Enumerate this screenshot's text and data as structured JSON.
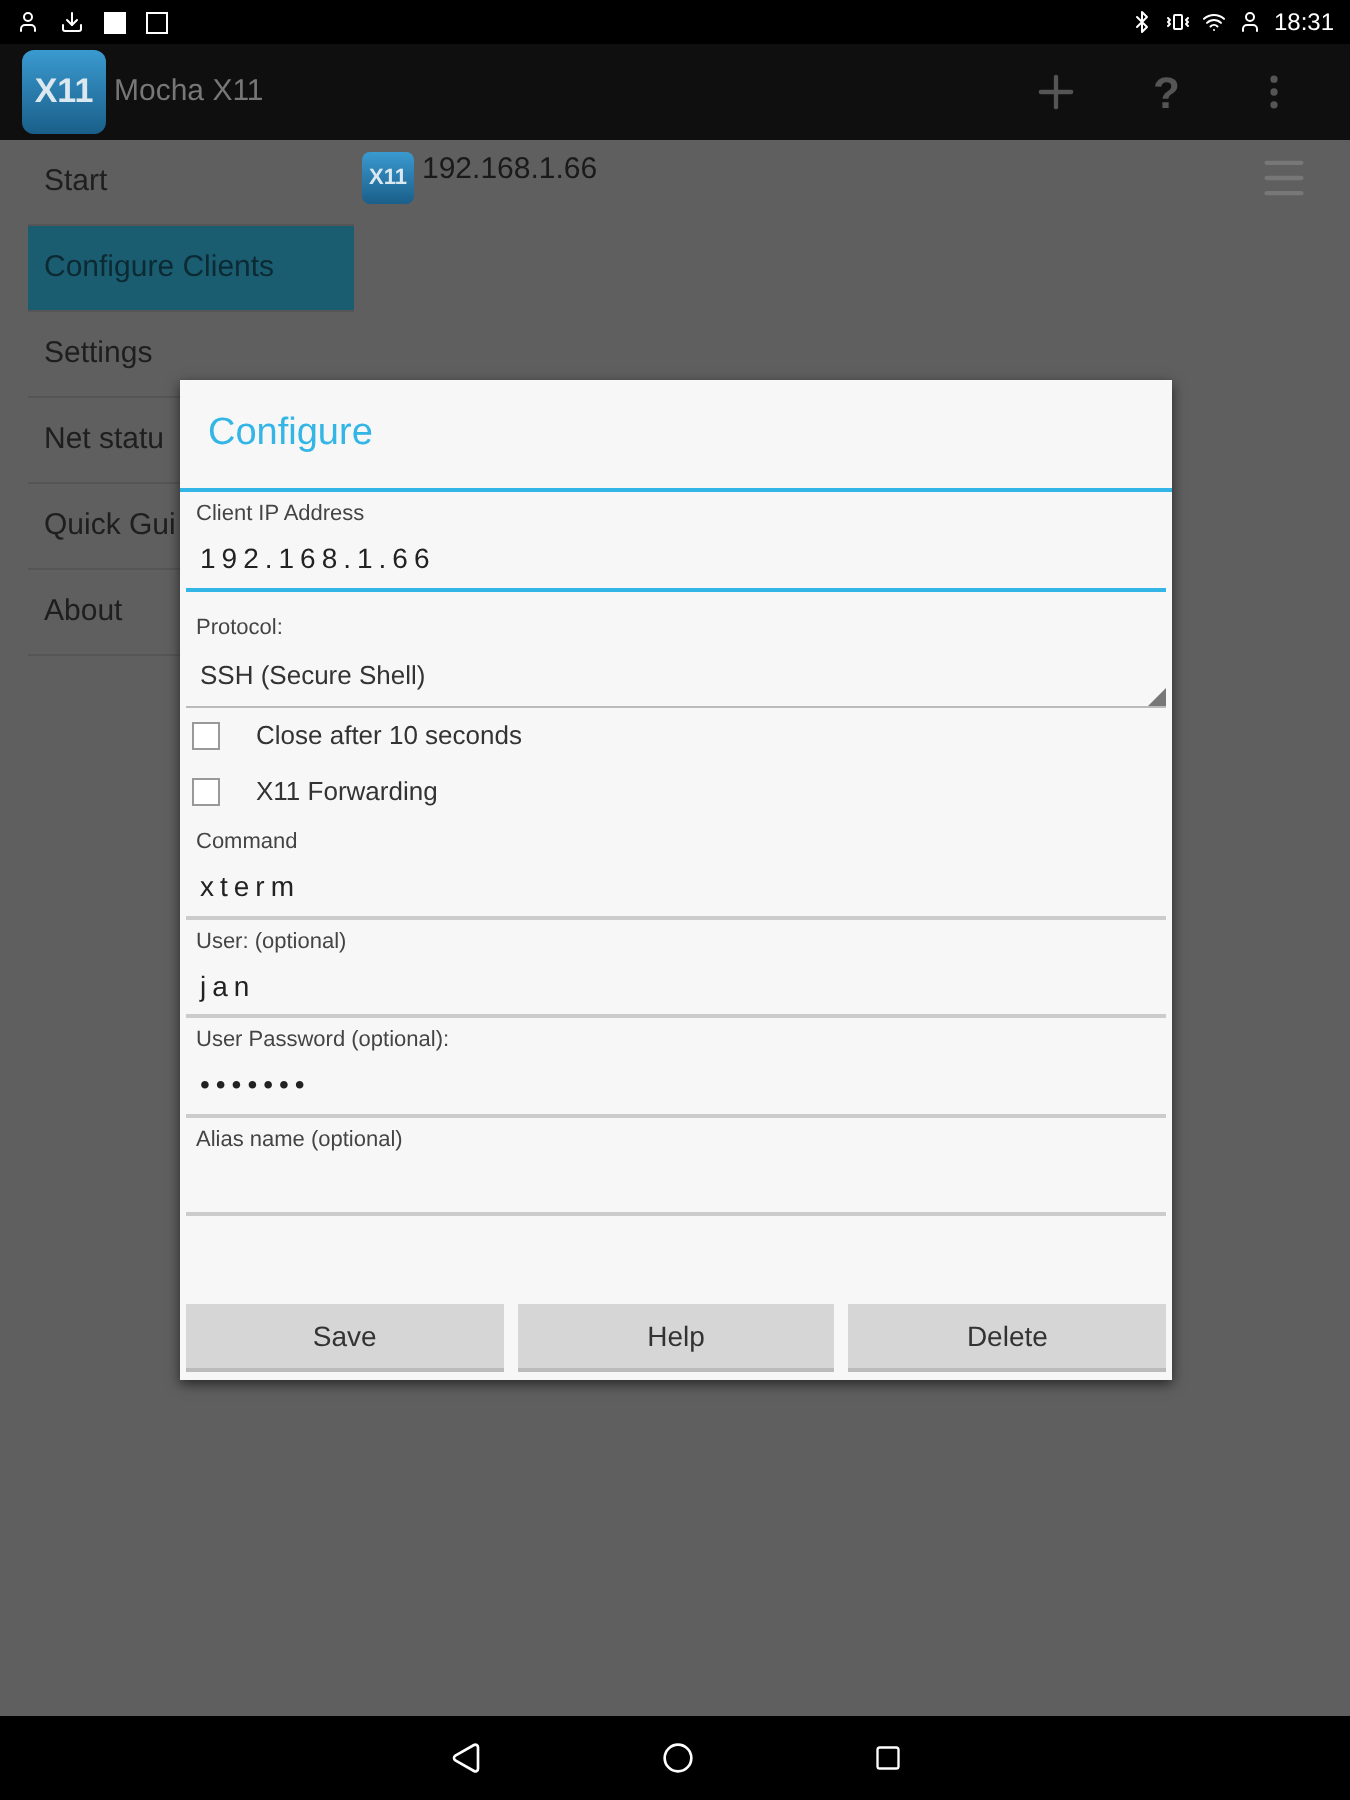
{
  "status_bar": {
    "time": "18:31"
  },
  "app_bar": {
    "logo": "X11",
    "title": "Mocha X11",
    "help": "?"
  },
  "sidebar": {
    "items": [
      {
        "label": "Start",
        "selected": false
      },
      {
        "label": "Configure Clients",
        "selected": true
      },
      {
        "label": "Settings",
        "selected": false
      },
      {
        "label": "Net statu",
        "selected": false
      },
      {
        "label": "Quick Gui",
        "selected": false
      },
      {
        "label": "About",
        "selected": false
      }
    ]
  },
  "clients": [
    {
      "logo": "X11",
      "address": "192.168.1.66"
    }
  ],
  "dialog": {
    "title": "Configure",
    "fields": [
      {
        "kind": "text",
        "label": "Client IP Address",
        "value": "192.168.1.66",
        "focused": true
      },
      {
        "kind": "select",
        "label": "Protocol:",
        "value": "SSH (Secure Shell)"
      },
      {
        "kind": "checkbox",
        "label": "Close after 10 seconds",
        "checked": false
      },
      {
        "kind": "checkbox",
        "label": "X11 Forwarding",
        "checked": false
      },
      {
        "kind": "text",
        "label": "Command",
        "value": "xterm",
        "focused": false
      },
      {
        "kind": "text",
        "label": "User: (optional)",
        "value": "jan",
        "focused": false
      },
      {
        "kind": "text",
        "label": "User Password (optional):",
        "value": "•••••••",
        "focused": false
      },
      {
        "kind": "text",
        "label": "Alias name (optional)",
        "focused": false
      }
    ],
    "buttons": [
      "Save",
      "Help",
      "Delete"
    ]
  }
}
